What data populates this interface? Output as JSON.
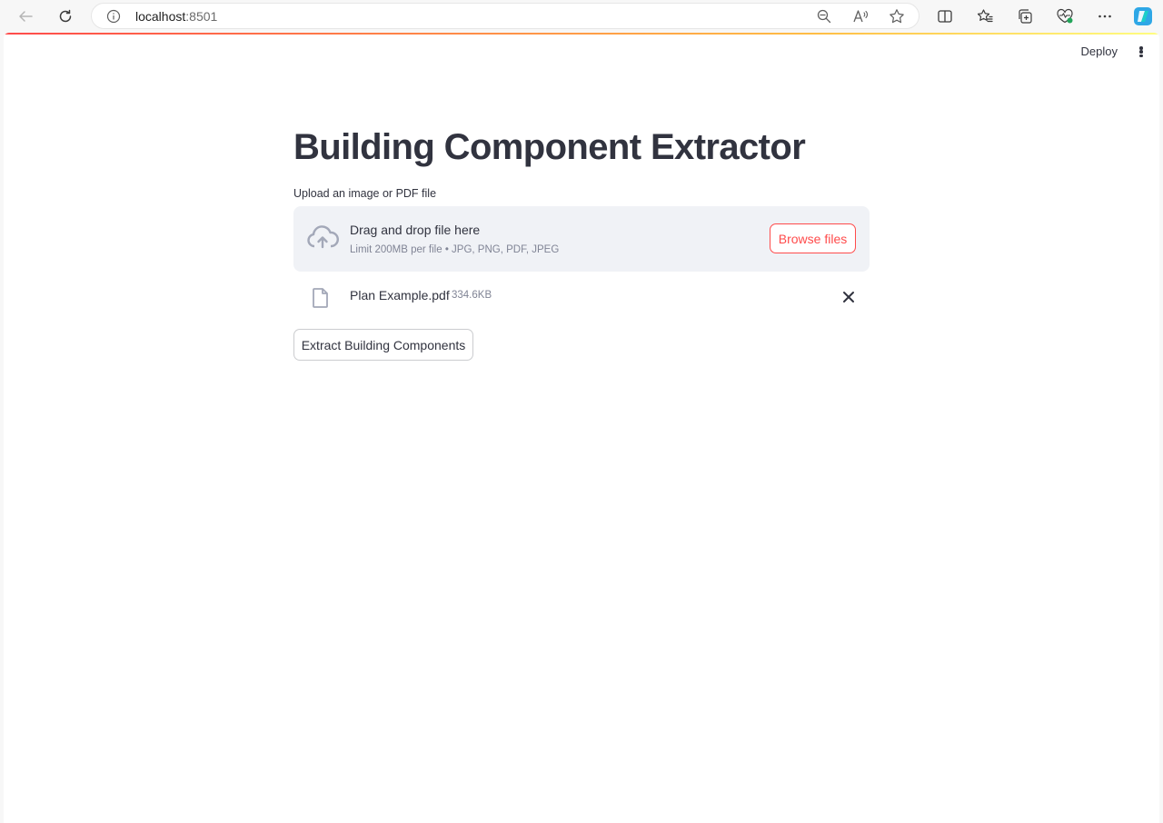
{
  "browser": {
    "url_host": "localhost",
    "url_port": ":8501"
  },
  "app": {
    "deploy_label": "Deploy",
    "title": "Building Component Extractor",
    "uploader": {
      "label": "Upload an image or PDF file",
      "dropzone_title": "Drag and drop file here",
      "dropzone_subtitle": "Limit 200MB per file • JPG, PNG, PDF, JPEG",
      "browse_label": "Browse files"
    },
    "uploaded_file": {
      "name": "Plan Example.pdf",
      "size": "334.6KB"
    },
    "extract_button_label": "Extract Building Components"
  },
  "colors": {
    "accent": "#ff4b4b",
    "text": "#31333f",
    "muted": "#808495",
    "dropzone_bg": "#f0f2f6"
  }
}
